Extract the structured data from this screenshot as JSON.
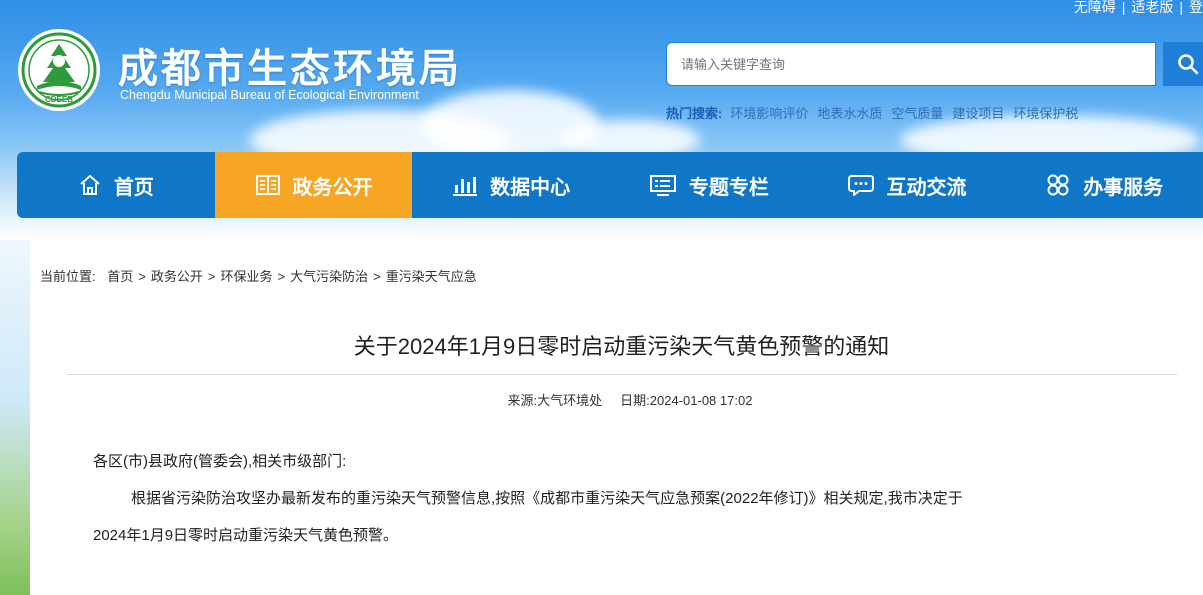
{
  "top_links": [
    "无障碍",
    "适老版",
    "登"
  ],
  "site": {
    "title": "成都市生态环境局",
    "subtitle": "Chengdu Municipal Bureau of Ecological Environment",
    "logo_text": "CDEEB"
  },
  "search": {
    "placeholder": "请输入关键字查询"
  },
  "hot_search": {
    "label": "热门搜索:",
    "items": [
      "环境影响评价",
      "地表水水质",
      "空气质量",
      "建设项目",
      "环境保护税"
    ]
  },
  "nav": [
    {
      "label": "首页",
      "icon": "home-icon"
    },
    {
      "label": "政务公开",
      "icon": "book-icon",
      "active": true
    },
    {
      "label": "数据中心",
      "icon": "bar-chart-icon"
    },
    {
      "label": "专题专栏",
      "icon": "topic-board-icon"
    },
    {
      "label": "互动交流",
      "icon": "chat-bubble-icon"
    },
    {
      "label": "办事服务",
      "icon": "service-grid-icon"
    }
  ],
  "breadcrumb": {
    "prefix": "当前位置:",
    "items": [
      "首页",
      "政务公开",
      "环保业务",
      "大气污染防治",
      "重污染天气应急"
    ],
    "separator": ">"
  },
  "article": {
    "title": "关于2024年1月9日零时启动重污染天气黄色预警的通知",
    "source": "来源:大气环境处",
    "date": "日期:2024-01-08 17:02",
    "salutation": "各区(市)县政府(管委会),相关市级部门:",
    "body_line1": "根据省污染防治攻坚办最新发布的重污染天气预警信息,按照《成都市重污染天气应急预案(2022年修订)》相关规定,我市决定于",
    "body_line2": "2024年1月9日零时启动重污染天气黄色预警。"
  },
  "colors": {
    "nav_bg": "#0f76c8",
    "nav_active": "#f6a623",
    "search_button": "#1f7fd8",
    "hot_link": "#2f6db5"
  }
}
